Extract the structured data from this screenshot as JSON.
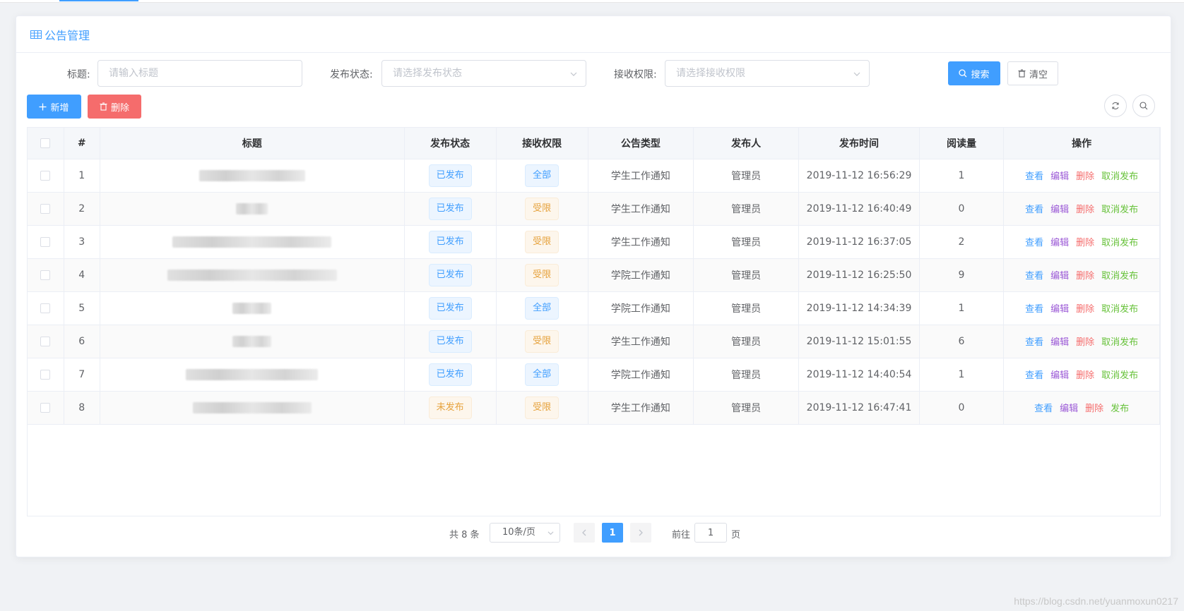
{
  "card": {
    "title": "公告管理"
  },
  "filters": {
    "title_label": "标题:",
    "title_placeholder": "请输入标题",
    "status_label": "发布状态:",
    "status_placeholder": "请选择发布状态",
    "perm_label": "接收权限:",
    "perm_placeholder": "请选择接收权限",
    "search_label": "搜索",
    "clear_label": "清空"
  },
  "toolbar": {
    "add_label": "新增",
    "delete_label": "删除"
  },
  "table": {
    "columns": [
      "#",
      "标题",
      "发布状态",
      "接收权限",
      "公告类型",
      "发布人",
      "发布时间",
      "阅读量",
      "操作"
    ],
    "rows": [
      {
        "no": "1",
        "status": "已发布",
        "perm": "全部",
        "type": "学生工作通知",
        "publisher": "管理员",
        "time": "2019-11-12 16:56:29",
        "reads": "1",
        "ops": [
          "查看",
          "编辑",
          "删除",
          "取消发布"
        ]
      },
      {
        "no": "2",
        "status": "已发布",
        "perm": "受限",
        "type": "学生工作通知",
        "publisher": "管理员",
        "time": "2019-11-12 16:40:49",
        "reads": "0",
        "ops": [
          "查看",
          "编辑",
          "删除",
          "取消发布"
        ]
      },
      {
        "no": "3",
        "status": "已发布",
        "perm": "受限",
        "type": "学生工作通知",
        "publisher": "管理员",
        "time": "2019-11-12 16:37:05",
        "reads": "2",
        "ops": [
          "查看",
          "编辑",
          "删除",
          "取消发布"
        ]
      },
      {
        "no": "4",
        "status": "已发布",
        "perm": "受限",
        "type": "学院工作通知",
        "publisher": "管理员",
        "time": "2019-11-12 16:25:50",
        "reads": "9",
        "ops": [
          "查看",
          "编辑",
          "删除",
          "取消发布"
        ]
      },
      {
        "no": "5",
        "status": "已发布",
        "perm": "全部",
        "type": "学院工作通知",
        "publisher": "管理员",
        "time": "2019-11-12 14:34:39",
        "reads": "1",
        "ops": [
          "查看",
          "编辑",
          "删除",
          "取消发布"
        ]
      },
      {
        "no": "6",
        "status": "已发布",
        "perm": "受限",
        "type": "学生工作通知",
        "publisher": "管理员",
        "time": "2019-11-12 15:01:55",
        "reads": "6",
        "ops": [
          "查看",
          "编辑",
          "删除",
          "取消发布"
        ]
      },
      {
        "no": "7",
        "status": "已发布",
        "perm": "全部",
        "type": "学院工作通知",
        "publisher": "管理员",
        "time": "2019-11-12 14:40:54",
        "reads": "1",
        "ops": [
          "查看",
          "编辑",
          "删除",
          "取消发布"
        ]
      },
      {
        "no": "8",
        "status": "未发布",
        "perm": "受限",
        "type": "学生工作通知",
        "publisher": "管理员",
        "time": "2019-11-12 16:47:41",
        "reads": "0",
        "ops": [
          "查看",
          "编辑",
          "删除",
          "发布"
        ]
      }
    ]
  },
  "pager": {
    "total": "共 8 条",
    "size": "10条/页",
    "current": "1",
    "goto": "前往",
    "jump_value": "1",
    "page_unit": "页"
  },
  "footer": {
    "link": "https://blog.csdn.net/yuanmoxun0217"
  }
}
